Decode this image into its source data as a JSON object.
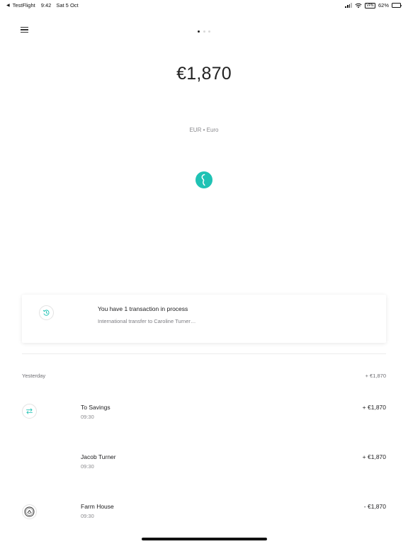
{
  "status_bar": {
    "back_app": "TestFlight",
    "time": "9:42",
    "date": "Sat 5 Oct",
    "vpn": "VPN",
    "battery_percent": "62%"
  },
  "header": {
    "page_count": 3,
    "active_page": 1
  },
  "account": {
    "balance": "€1,870",
    "currency": "EUR • Euro",
    "accent_color": "#1fc2b4"
  },
  "pending": {
    "title": "You have 1 transaction in process",
    "subtitle": "International transfer to Caroline Turner…"
  },
  "activity": {
    "day_label": "Yesterday",
    "day_total": "+ €1,870",
    "transactions": [
      {
        "name": "To Savings",
        "time": "09:30",
        "amount": "+ €1,870",
        "icon": "transfer-icon"
      },
      {
        "name": "Jacob Turner",
        "time": "09:30",
        "amount": "+ €1,870",
        "icon": ""
      },
      {
        "name": "Farm House",
        "time": "09:30",
        "amount": "- €1,870",
        "icon": "farm-house-logo-icon"
      }
    ]
  }
}
